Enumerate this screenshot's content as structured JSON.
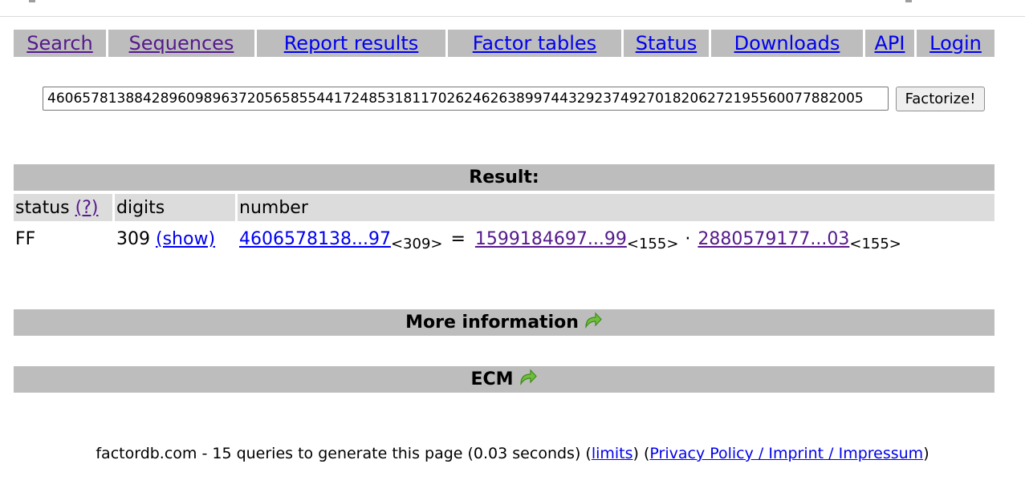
{
  "nav": {
    "items": [
      {
        "label": "Search",
        "visited": true
      },
      {
        "label": "Sequences",
        "visited": true
      },
      {
        "label": "Report results",
        "visited": false
      },
      {
        "label": "Factor tables",
        "visited": false
      },
      {
        "label": "Status",
        "visited": false
      },
      {
        "label": "Downloads",
        "visited": false
      },
      {
        "label": "API",
        "visited": false
      },
      {
        "label": "Login",
        "visited": false
      }
    ]
  },
  "search": {
    "value": "4606578138842896098963720565855441724853181170262462638997443292374927018206272195560077882005",
    "button_label": "Factorize!"
  },
  "result": {
    "header": "Result:",
    "columns": {
      "status": "status",
      "status_help": "(?)",
      "digits": "digits",
      "number": "number"
    },
    "row": {
      "status": "FF",
      "digits": "309",
      "show": "(show)",
      "number": "4606578138...97",
      "number_sub": "<309>",
      "equals": "=",
      "factor1": "1599184697...99",
      "factor1_sub": "<155>",
      "times": "·",
      "factor2": "2880579177...03",
      "factor2_sub": "<155>"
    }
  },
  "sections": {
    "more_info": "More information",
    "ecm": "ECM"
  },
  "icons": {
    "expand": "green-curved-arrow-icon"
  },
  "footer": {
    "text_main": "factordb.com - 15 queries to generate this page (0.03 seconds) (",
    "limits": "limits",
    "mid": ") (",
    "privacy": "Privacy Policy / Imprint / Impressum",
    "end": ")"
  }
}
